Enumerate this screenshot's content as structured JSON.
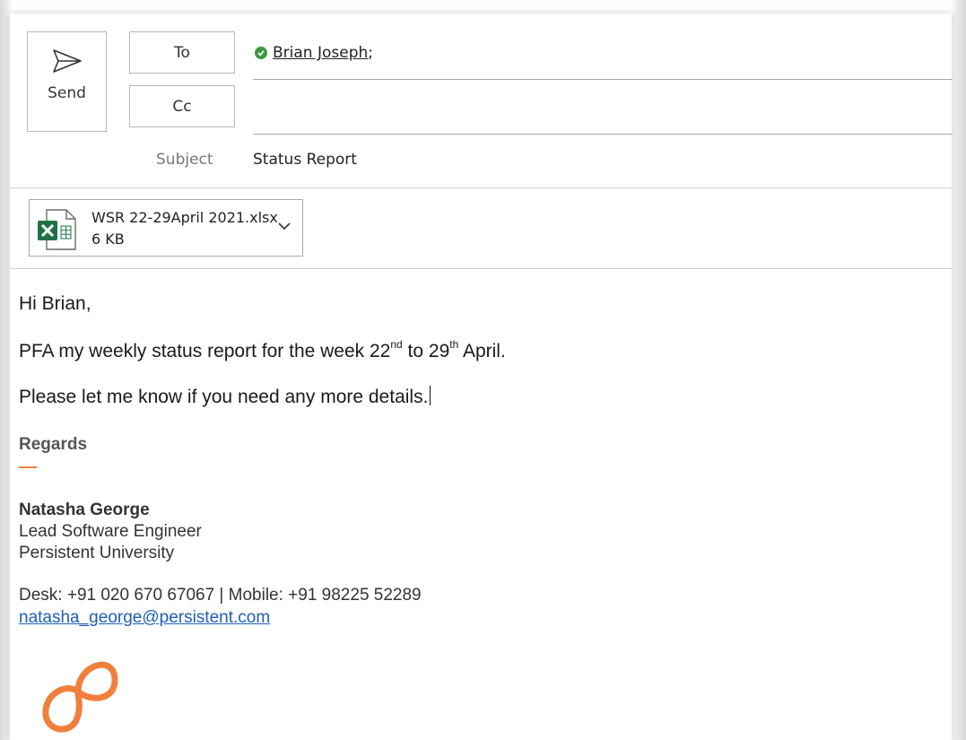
{
  "header": {
    "send_label": "Send",
    "to_label": "To",
    "cc_label": "Cc",
    "recipient": "Brian Joseph",
    "recipient_sep": ";",
    "subject_label": "Subject",
    "subject_value": "Status Report"
  },
  "attachment": {
    "filename": "WSR 22-29April 2021.xlsx",
    "size": "6 KB",
    "icon": "excel-file-icon"
  },
  "message": {
    "greeting": "Hi Brian,",
    "line1_pre": "PFA my weekly status report for the week 22",
    "line1_sup1": "nd",
    "line1_mid": " to 29",
    "line1_sup2": "th",
    "line1_post": " April.",
    "line2": "Please let me know if you need any more details."
  },
  "signature": {
    "regards": "Regards",
    "name": "Natasha George",
    "title": "Lead Software Engineer",
    "company": "Persistent University",
    "phones": "Desk: +91 020 670 67067 | Mobile: +91 98225 52289",
    "email": "natasha_george@persistent.com",
    "logo_icon": "persistent-logo"
  },
  "colors": {
    "accent_orange": "#f07f3c",
    "link_blue": "#1f5fb5",
    "excel_green": "#1e7145",
    "check_green": "#3c9a3c"
  }
}
